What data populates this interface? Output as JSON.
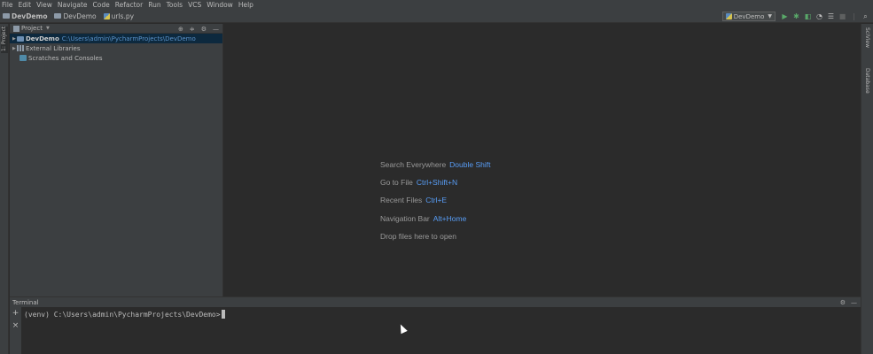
{
  "menu": [
    "File",
    "Edit",
    "View",
    "Navigate",
    "Code",
    "Refactor",
    "Run",
    "Tools",
    "VCS",
    "Window",
    "Help"
  ],
  "breadcrumb": {
    "project": "DevDemo",
    "folder": "DevDemo",
    "file": "urls.py"
  },
  "run_config": {
    "name": "DevDemo"
  },
  "side_tabs": {
    "project": "1: Project",
    "structure_right": "SciView",
    "database_right": "Database"
  },
  "project_panel": {
    "title": "Project",
    "tree": [
      {
        "name": "DevDemo",
        "path": "C:\\Users\\admin\\PycharmProjects\\DevDemo"
      },
      {
        "name": "External Libraries"
      },
      {
        "name": "Scratches and Consoles"
      }
    ]
  },
  "editor_hints": [
    {
      "label": "Search Everywhere",
      "key": "Double Shift"
    },
    {
      "label": "Go to File",
      "key": "Ctrl+Shift+N"
    },
    {
      "label": "Recent Files",
      "key": "Ctrl+E"
    },
    {
      "label": "Navigation Bar",
      "key": "Alt+Home"
    },
    {
      "label": "Drop files here to open",
      "key": ""
    }
  ],
  "terminal": {
    "title": "Terminal",
    "prompt": "(venv) C:\\Users\\admin\\PycharmProjects\\DevDemo>"
  },
  "colors": {
    "accent_link": "#589df6",
    "selection": "#0d293e",
    "panel_bg": "#3c3f41",
    "editor_bg": "#2b2b2b"
  }
}
